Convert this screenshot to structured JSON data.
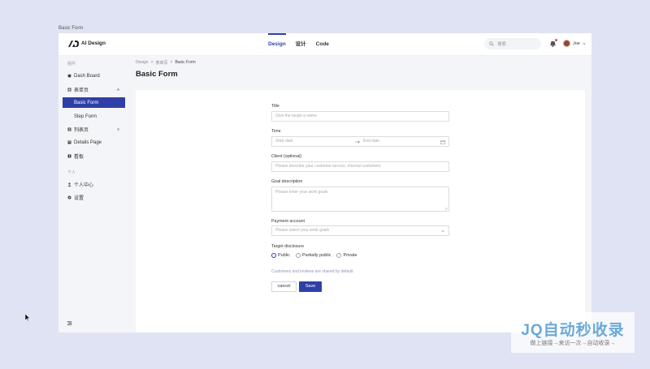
{
  "page_caption": "Basic Form",
  "header": {
    "brand": "AI Design",
    "nav": [
      {
        "label": "Design",
        "active": true
      },
      {
        "label": "设计",
        "active": false
      },
      {
        "label": "Code",
        "active": false
      }
    ],
    "search_placeholder": "搜索",
    "user_name": "Joe"
  },
  "sidebar": {
    "group1": "组件",
    "group2": "个人",
    "items": [
      {
        "label": "Dash Board",
        "icon": "dashboard-icon"
      },
      {
        "label": "表单页",
        "icon": "form-icon"
      },
      {
        "label": "Basic Form",
        "icon": ""
      },
      {
        "label": "Step Form",
        "icon": ""
      },
      {
        "label": "列表页",
        "icon": "list-icon"
      },
      {
        "label": "Details Page",
        "icon": "details-icon"
      },
      {
        "label": "看板",
        "icon": "board-icon"
      },
      {
        "label": "个人中心",
        "icon": "user-icon"
      },
      {
        "label": "设置",
        "icon": "gear-icon"
      }
    ]
  },
  "breadcrumb": [
    "Design",
    "表单页",
    "Basic Form"
  ],
  "page_title": "Basic Form",
  "form": {
    "title_label": "Title",
    "title_placeholder": "Give the target a name",
    "time_label": "Time",
    "start_placeholder": "Start date",
    "end_placeholder": "End date",
    "client_label": "Client (optional)",
    "client_placeholder": "Please describe your customer service, internal customers",
    "goal_label": "Goal description",
    "goal_placeholder": "Please enter your work goals",
    "payment_label": "Payment account",
    "payment_placeholder": "Please select your work goals",
    "disclosure_label": "Target disclosure",
    "radios": [
      {
        "label": "Public",
        "checked": true
      },
      {
        "label": "Partially public",
        "checked": false
      },
      {
        "label": "Private",
        "checked": false
      }
    ],
    "hint": "Customers and invitees are shared by default",
    "cancel_label": "cancel",
    "save_label": "Save"
  },
  "watermark": {
    "big": "JQ自动秒收录",
    "small": "做上链接→来访一次→自动收录→"
  },
  "colors": {
    "accent": "#2f3fa8",
    "sidebar_bg": "#f4f5f8",
    "desktop_bg": "#dfe3f3"
  }
}
